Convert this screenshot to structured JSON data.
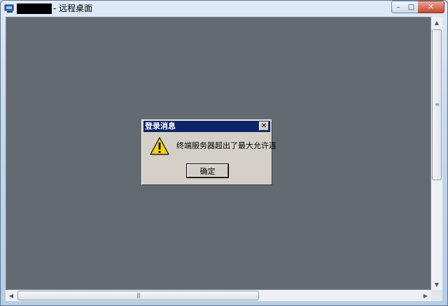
{
  "window": {
    "title": "- 远程桌面",
    "controls": {
      "minimize": "–",
      "maximize": "□",
      "close": "✕"
    }
  },
  "dialog": {
    "title": "登录消息",
    "close": "✕",
    "message": "终端服务器超出了最大允许连",
    "ok_label": "确定",
    "icon": "warning-icon"
  },
  "scrollbars": {
    "up": "▲",
    "down": "▼",
    "left": "◀",
    "right": "▶",
    "grip_v": "≡",
    "grip_h": "|||"
  },
  "colors": {
    "desktop": "#646b70",
    "dialog_titlebar": "#0a246a",
    "dialog_face": "#d4d0c8"
  }
}
